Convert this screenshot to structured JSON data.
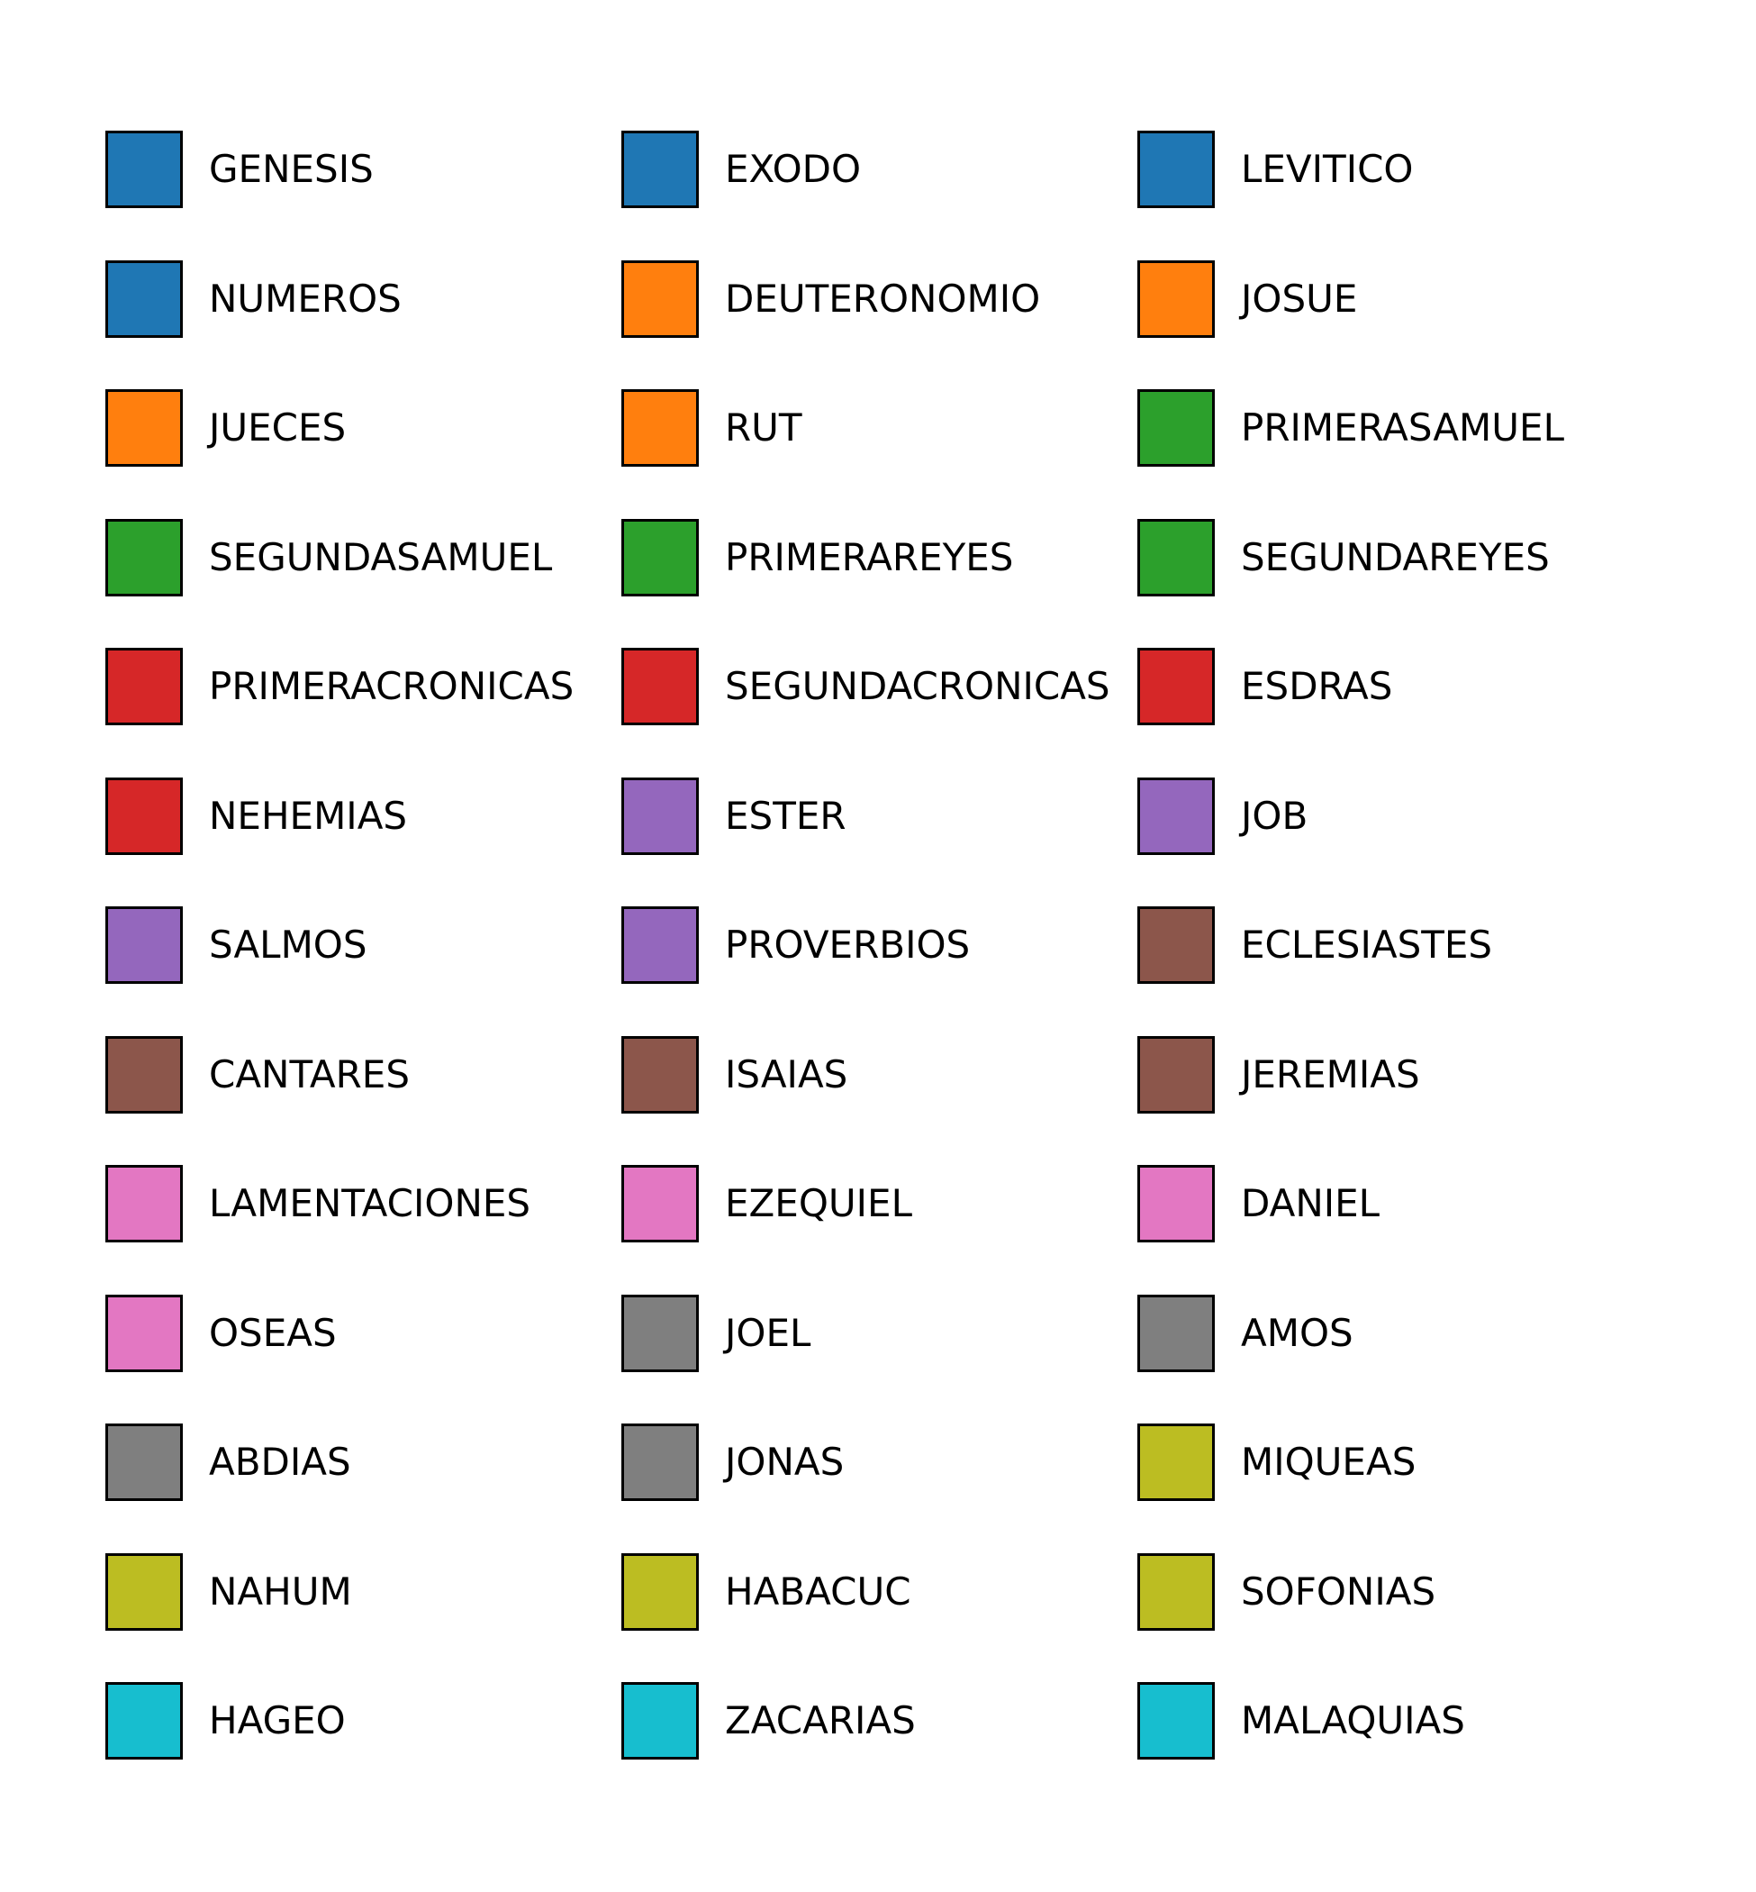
{
  "chart_data": {
    "type": "legend",
    "title": "",
    "columns": 3,
    "entries": [
      {
        "label": "GENESIS",
        "color": "#1f77b4"
      },
      {
        "label": "EXODO",
        "color": "#1f77b4"
      },
      {
        "label": "LEVITICO",
        "color": "#1f77b4"
      },
      {
        "label": "NUMEROS",
        "color": "#1f77b4"
      },
      {
        "label": "DEUTERONOMIO",
        "color": "#ff7f0e"
      },
      {
        "label": "JOSUE",
        "color": "#ff7f0e"
      },
      {
        "label": "JUECES",
        "color": "#ff7f0e"
      },
      {
        "label": "RUT",
        "color": "#ff7f0e"
      },
      {
        "label": "PRIMERASAMUEL",
        "color": "#2ca02c"
      },
      {
        "label": "SEGUNDASAMUEL",
        "color": "#2ca02c"
      },
      {
        "label": "PRIMERAREYES",
        "color": "#2ca02c"
      },
      {
        "label": "SEGUNDAREYES",
        "color": "#2ca02c"
      },
      {
        "label": "PRIMERACRONICAS",
        "color": "#d62728"
      },
      {
        "label": "SEGUNDACRONICAS",
        "color": "#d62728"
      },
      {
        "label": "ESDRAS",
        "color": "#d62728"
      },
      {
        "label": "NEHEMIAS",
        "color": "#d62728"
      },
      {
        "label": "ESTER",
        "color": "#9467bd"
      },
      {
        "label": "JOB",
        "color": "#9467bd"
      },
      {
        "label": "SALMOS",
        "color": "#9467bd"
      },
      {
        "label": "PROVERBIOS",
        "color": "#9467bd"
      },
      {
        "label": "ECLESIASTES",
        "color": "#8c564b"
      },
      {
        "label": "CANTARES",
        "color": "#8c564b"
      },
      {
        "label": "ISAIAS",
        "color": "#8c564b"
      },
      {
        "label": "JEREMIAS",
        "color": "#8c564b"
      },
      {
        "label": "LAMENTACIONES",
        "color": "#e377c2"
      },
      {
        "label": "EZEQUIEL",
        "color": "#e377c2"
      },
      {
        "label": "DANIEL",
        "color": "#e377c2"
      },
      {
        "label": "OSEAS",
        "color": "#e377c2"
      },
      {
        "label": "JOEL",
        "color": "#7f7f7f"
      },
      {
        "label": "AMOS",
        "color": "#7f7f7f"
      },
      {
        "label": "ABDIAS",
        "color": "#7f7f7f"
      },
      {
        "label": "JONAS",
        "color": "#7f7f7f"
      },
      {
        "label": "MIQUEAS",
        "color": "#bcbd22"
      },
      {
        "label": "NAHUM",
        "color": "#bcbd22"
      },
      {
        "label": "HABACUC",
        "color": "#bcbd22"
      },
      {
        "label": "SOFONIAS",
        "color": "#bcbd22"
      },
      {
        "label": "HAGEO",
        "color": "#17becf"
      },
      {
        "label": "ZACARIAS",
        "color": "#17becf"
      },
      {
        "label": "MALAQUIAS",
        "color": "#17becf"
      }
    ]
  }
}
